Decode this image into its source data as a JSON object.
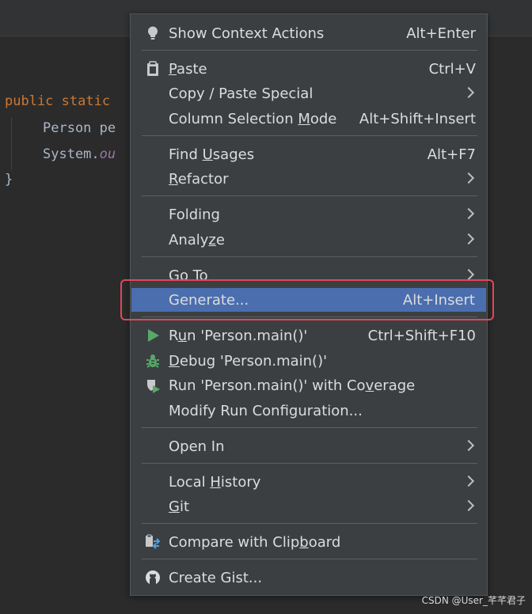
{
  "editor": {
    "line1_kw": "public static",
    "line2": "Person pe",
    "line3_a": "System.",
    "line3_b": "ou",
    "line4": "}"
  },
  "menu": {
    "show_context_actions": {
      "label": "Show Context Actions",
      "shortcut": "Alt+Enter",
      "icon": "lightbulb-icon"
    },
    "paste": {
      "label_mn": "P",
      "label_rest": "aste",
      "shortcut": "Ctrl+V",
      "icon": "clipboard-icon"
    },
    "copy_paste_special": {
      "label": "Copy / Paste Special"
    },
    "column_selection_mode": {
      "label_pre": "Column Selection ",
      "label_mn": "M",
      "label_post": "ode",
      "shortcut": "Alt+Shift+Insert"
    },
    "find_usages": {
      "label_pre": "Find ",
      "label_mn": "U",
      "label_post": "sages",
      "shortcut": "Alt+F7"
    },
    "refactor": {
      "label_mn": "R",
      "label_post": "efactor"
    },
    "folding": {
      "label": "Folding"
    },
    "analyze": {
      "label_pre": "Analy",
      "label_mn": "z",
      "label_post": "e"
    },
    "go_to": {
      "label": "Go To"
    },
    "generate": {
      "label": "Generate...",
      "shortcut": "Alt+Insert"
    },
    "run": {
      "label_pre": "R",
      "label_mn": "u",
      "label_post": "n 'Person.main()'",
      "shortcut": "Ctrl+Shift+F10",
      "icon": "run-icon"
    },
    "debug": {
      "label_mn": "D",
      "label_post": "ebug 'Person.main()'",
      "icon": "debug-icon"
    },
    "run_coverage": {
      "label_pre": "Run 'Person.main()' with Co",
      "label_mn": "v",
      "label_post": "erage",
      "icon": "coverage-icon"
    },
    "modify_run_config": {
      "label": "Modify Run Configuration..."
    },
    "open_in": {
      "label": "Open In"
    },
    "local_history": {
      "label_pre": "Local ",
      "label_mn": "H",
      "label_post": "istory"
    },
    "git": {
      "label_mn": "G",
      "label_post": "it"
    },
    "compare_clipboard": {
      "label_pre": "Compare with Clip",
      "label_mn": "b",
      "label_post": "oard",
      "icon": "compare-icon"
    },
    "create_gist": {
      "label": "Create Gist...",
      "icon": "github-icon"
    }
  },
  "colors": {
    "accent": "#4b6eaf",
    "annotation": "#e0485a",
    "run_green": "#59a869"
  },
  "watermark": "CSDN @User_芊芊君子"
}
